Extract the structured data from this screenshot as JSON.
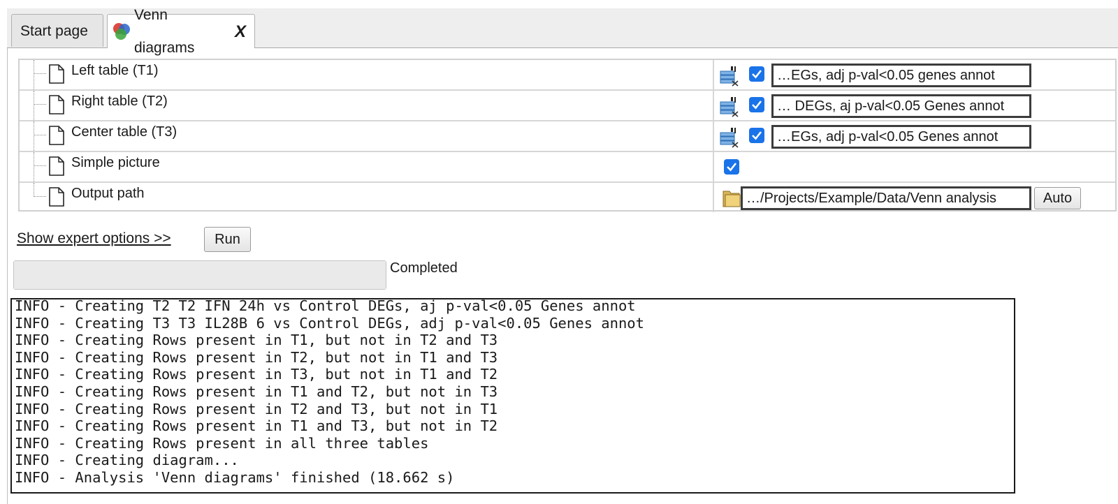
{
  "tabs": [
    {
      "label": "Start page",
      "active": false
    },
    {
      "label": "Venn diagrams",
      "active": true,
      "close_label": "X",
      "icon": "venn-icon"
    }
  ],
  "params": {
    "left_table": {
      "label": "Left table (T1)",
      "checked": true,
      "value": "…EGs, adj p-val<0.05 genes annot"
    },
    "right_table": {
      "label": "Right table (T2)",
      "checked": true,
      "value": "… DEGs, aj p-val<0.05 Genes annot"
    },
    "center_table": {
      "label": "Center table (T3)",
      "checked": true,
      "value": "…EGs, adj p-val<0.05 Genes annot"
    },
    "simple_picture": {
      "label": "Simple picture",
      "checked": true
    },
    "output_path": {
      "label": "Output path",
      "value": "…/Projects/Example/Data/Venn analysis",
      "auto_label": "Auto"
    }
  },
  "controls": {
    "expert_link": "Show expert options >>",
    "run_label": "Run",
    "status": "Completed",
    "progress": 1.0
  },
  "log": [
    "INFO - Creating T2 T2 IFN 24h vs Control DEGs, aj p-val<0.05 Genes annot",
    "INFO - Creating T3 T3 IL28B 6 vs Control DEGs, adj p-val<0.05 Genes annot",
    "INFO - Creating Rows present in T1, but not in T2 and T3",
    "INFO - Creating Rows present in T2, but not in T1 and T3",
    "INFO - Creating Rows present in T3, but not in T1 and T2",
    "INFO - Creating Rows present in T1 and T2, but not in T3",
    "INFO - Creating Rows present in T2 and T3, but not in T1",
    "INFO - Creating Rows present in T1 and T3, but not in T2",
    "INFO - Creating Rows present in all three tables",
    "INFO - Creating diagram...",
    "INFO - Analysis 'Venn diagrams' finished (18.662 s)"
  ],
  "colors": {
    "checkbox": "#1a73e8",
    "frame_border": "#bdbdbd",
    "progress_track": "#eaeaea"
  }
}
